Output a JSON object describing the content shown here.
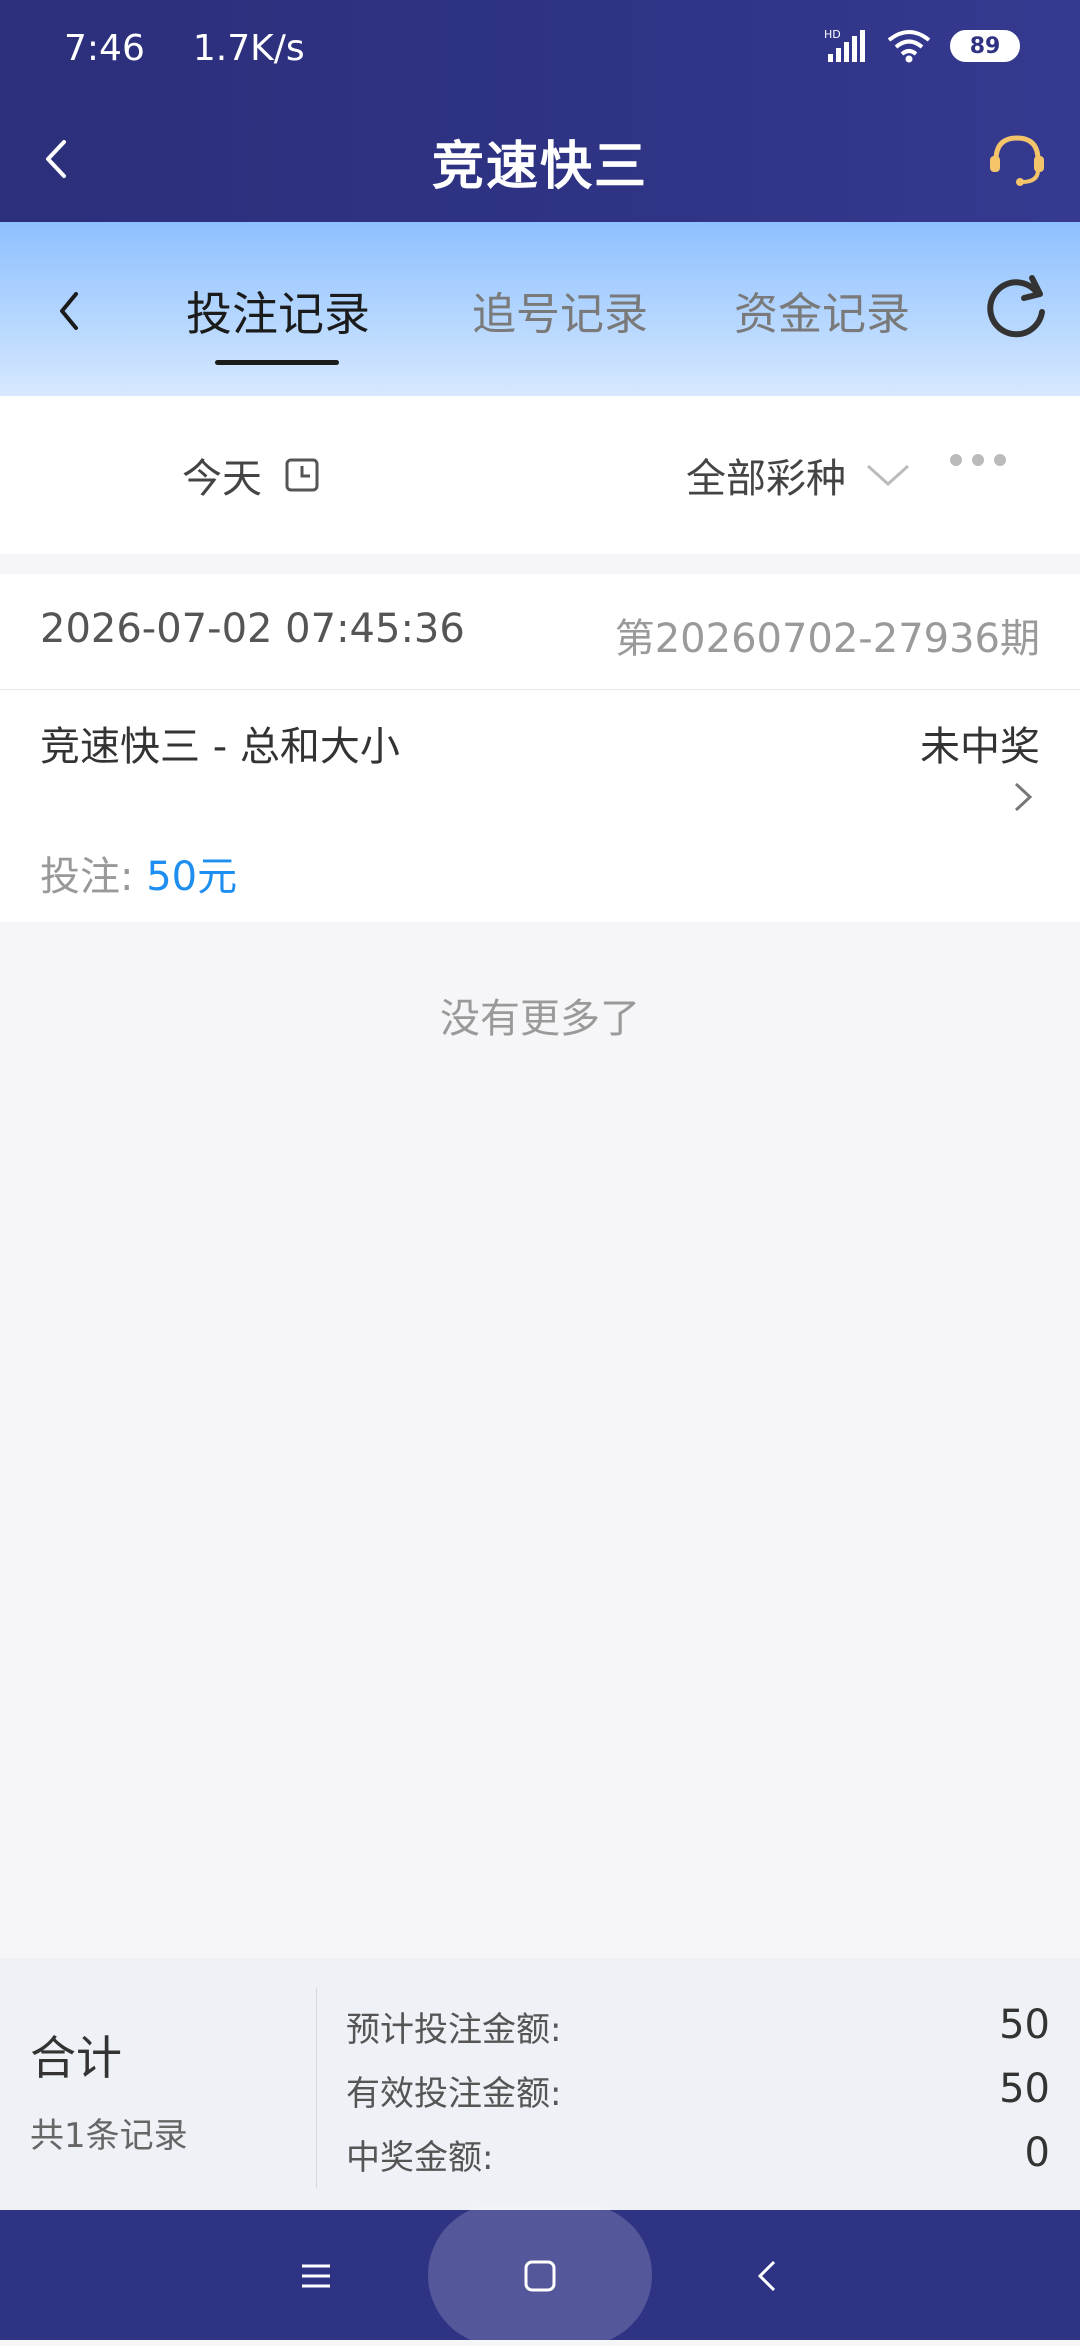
{
  "status_bar": {
    "time": "7:46",
    "speed": "1.7K/s",
    "battery": "89",
    "network_label": "HD"
  },
  "nav": {
    "title": "竞速快三"
  },
  "tabs": {
    "items": [
      "投注记录",
      "追号记录",
      "资金记录"
    ],
    "active_index": 0
  },
  "filter": {
    "date": "今天",
    "lottery": "全部彩种"
  },
  "record": {
    "time": "2026-07-02 07:45:36",
    "issue": "第20260702-27936期",
    "game": "竞速快三 - 总和大小",
    "status": "未中奖",
    "stake_label": "投注:",
    "stake_amount": "50元"
  },
  "list_end_text": "没有更多了",
  "summary": {
    "label": "合计",
    "count": "共1条记录",
    "rows": [
      {
        "label": "预计投注金额:",
        "value": "50"
      },
      {
        "label": "有效投注金额:",
        "value": "50"
      },
      {
        "label": "中奖金额:",
        "value": "0"
      }
    ]
  },
  "colors": {
    "header": "#2f3384",
    "accent_blue": "#1e8ff0",
    "tab_gradient_top": "#8ec0ff"
  }
}
